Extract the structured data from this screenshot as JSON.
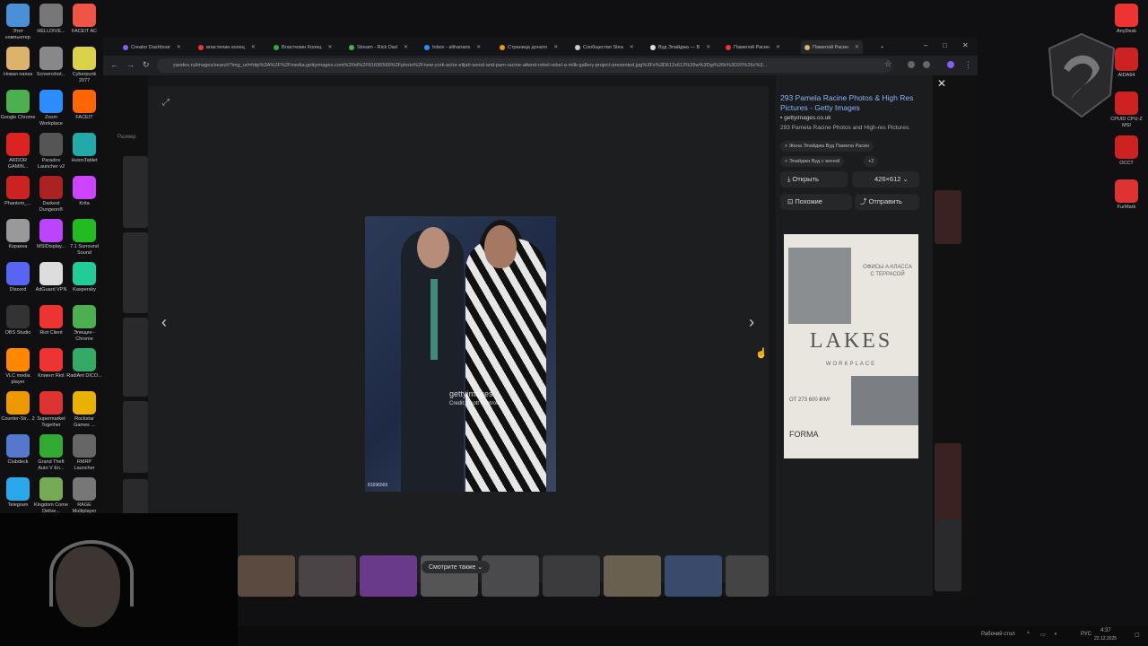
{
  "desktop": {
    "icons_left": [
      {
        "label": "Этот компьютер",
        "color": "#4a90d9"
      },
      {
        "label": "HELLDIVE...",
        "color": "#777"
      },
      {
        "label": "FACEIT AC",
        "color": "#e54"
      },
      {
        "label": "Новая папка",
        "color": "#dcb36a"
      },
      {
        "label": "Screenshot...",
        "color": "#888"
      },
      {
        "label": "Cyberpunk 2077",
        "color": "#d9d24a"
      },
      {
        "label": "Google Chrome",
        "color": "#4caf50"
      },
      {
        "label": "Zoom Workplace",
        "color": "#2d8cff"
      },
      {
        "label": "FACEIT",
        "color": "#f60"
      },
      {
        "label": "ARDOR GAMIN...",
        "color": "#d22"
      },
      {
        "label": "Paradox Launcher v2",
        "color": "#555"
      },
      {
        "label": "HuionTablet",
        "color": "#2aa"
      },
      {
        "label": "Phantom_...",
        "color": "#c22"
      },
      {
        "label": "Darkest Dungeon®",
        "color": "#a22"
      },
      {
        "label": "Krita",
        "color": "#c4f"
      },
      {
        "label": "Корзина",
        "color": "#999"
      },
      {
        "label": "MSIDisplay...",
        "color": "#b4f"
      },
      {
        "label": "7.1 Surround Sound",
        "color": "#2b2"
      },
      {
        "label": "Discord",
        "color": "#5865f2"
      },
      {
        "label": "AdGuard VPN",
        "color": "#ddd"
      },
      {
        "label": "Kaspersky",
        "color": "#2c9"
      },
      {
        "label": "OBS Studio",
        "color": "#333"
      },
      {
        "label": "Riot Client",
        "color": "#e33"
      },
      {
        "label": "Элещин - Chrome",
        "color": "#4caf50"
      },
      {
        "label": "VLC media player",
        "color": "#f80"
      },
      {
        "label": "Клиент Riot",
        "color": "#e33"
      },
      {
        "label": "RadiAnt DICO...",
        "color": "#3a6"
      },
      {
        "label": "Counter-Str... 2",
        "color": "#e90"
      },
      {
        "label": "Supermarket Together",
        "color": "#d33"
      },
      {
        "label": "Rockstar Games ...",
        "color": "#e9b200"
      },
      {
        "label": "Clubdeck",
        "color": "#57c"
      },
      {
        "label": "Grand Theft Auto V En...",
        "color": "#3a3"
      },
      {
        "label": "RMRP Launcher",
        "color": "#666"
      },
      {
        "label": "Telegram",
        "color": "#29a9eb"
      },
      {
        "label": "Kingdom Come Delive...",
        "color": "#7a5"
      },
      {
        "label": "RAGE Multiplayer",
        "color": "#777"
      },
      {
        "label": "",
        "color": "#d22"
      },
      {
        "label": "",
        "color": "#8a5cf6"
      },
      {
        "label": "",
        "color": "#ccc"
      }
    ],
    "icons_right": [
      {
        "label": "AnyDesk",
        "color": "#e33"
      },
      {
        "label": "AIDA64",
        "color": "#c22"
      },
      {
        "label": "CPUID CPU-Z MSI",
        "color": "#c22"
      },
      {
        "label": "OCCT",
        "color": "#c22"
      },
      {
        "label": "FurMark",
        "color": "#d33"
      }
    ]
  },
  "browser": {
    "tabs": [
      {
        "label": "Creator Dashboar",
        "color": "#8a5cf6"
      },
      {
        "label": "властелин колец",
        "color": "#e33"
      },
      {
        "label": "Властелин Колец",
        "color": "#3a3"
      },
      {
        "label": "Stream - Rick Dad",
        "color": "#4caf50"
      },
      {
        "label": "Inbox - althanaris",
        "color": "#2d8cff"
      },
      {
        "label": "Страница донато",
        "color": "#e90"
      },
      {
        "label": "Сообщество Stea",
        "color": "#ccc"
      },
      {
        "label": "Вуд Элайджа — В",
        "color": "#ddd"
      },
      {
        "label": "Памелой Расин",
        "color": "#e33"
      },
      {
        "label": "Памелой Расин",
        "color": "#dcb36a"
      }
    ],
    "new_tab": "+",
    "url": "yandex.ru/images/search?img_url=http%3A%2F%2Fmedia.gettyimages.com%2Fid%2F81696566%2Fphoto%2Fnew-york-actor-elijah-wood-and-pam-racine-attend-rebel-rebel-a-milk-gallery-project-presented.jpg%3Fs%3D612x612%26w%3Dgi%26k%3D20%26c%3..."
  },
  "page": {
    "razmer_label": "Размер",
    "photo": {
      "watermark": "gettyimages",
      "credit": "Credit: Scott Wintrow",
      "id": "81696566"
    },
    "see_also_label": "Смотрите также",
    "panel": {
      "title": "293 Pamela Racine Photos & High Res Pictures - Getty Images",
      "site": "gettyimages.co.uk",
      "description": "293 Pamela Racine Photos and High-res Pictures.",
      "chips": [
        "Жена Элайджа Вуд Памела Расин",
        "Элайджа Вуд с женой",
        "+2"
      ],
      "open_label": "Открыть",
      "size_label": "426×612",
      "similar_label": "Похожие",
      "share_label": "Отправить"
    },
    "ad": {
      "tagline": "ОФИСЫ А-КЛАССА С ТЕРРАСОЙ",
      "brand": "LAKES",
      "sub": "WORKPLACE",
      "price": "ОТ 273 600 ₽/М²",
      "developer": "FORMA"
    }
  },
  "taskbar": {
    "desktop_label": "Рабочий стол",
    "lang": "РУС",
    "time": "4:37",
    "date": "22.12.2025"
  }
}
